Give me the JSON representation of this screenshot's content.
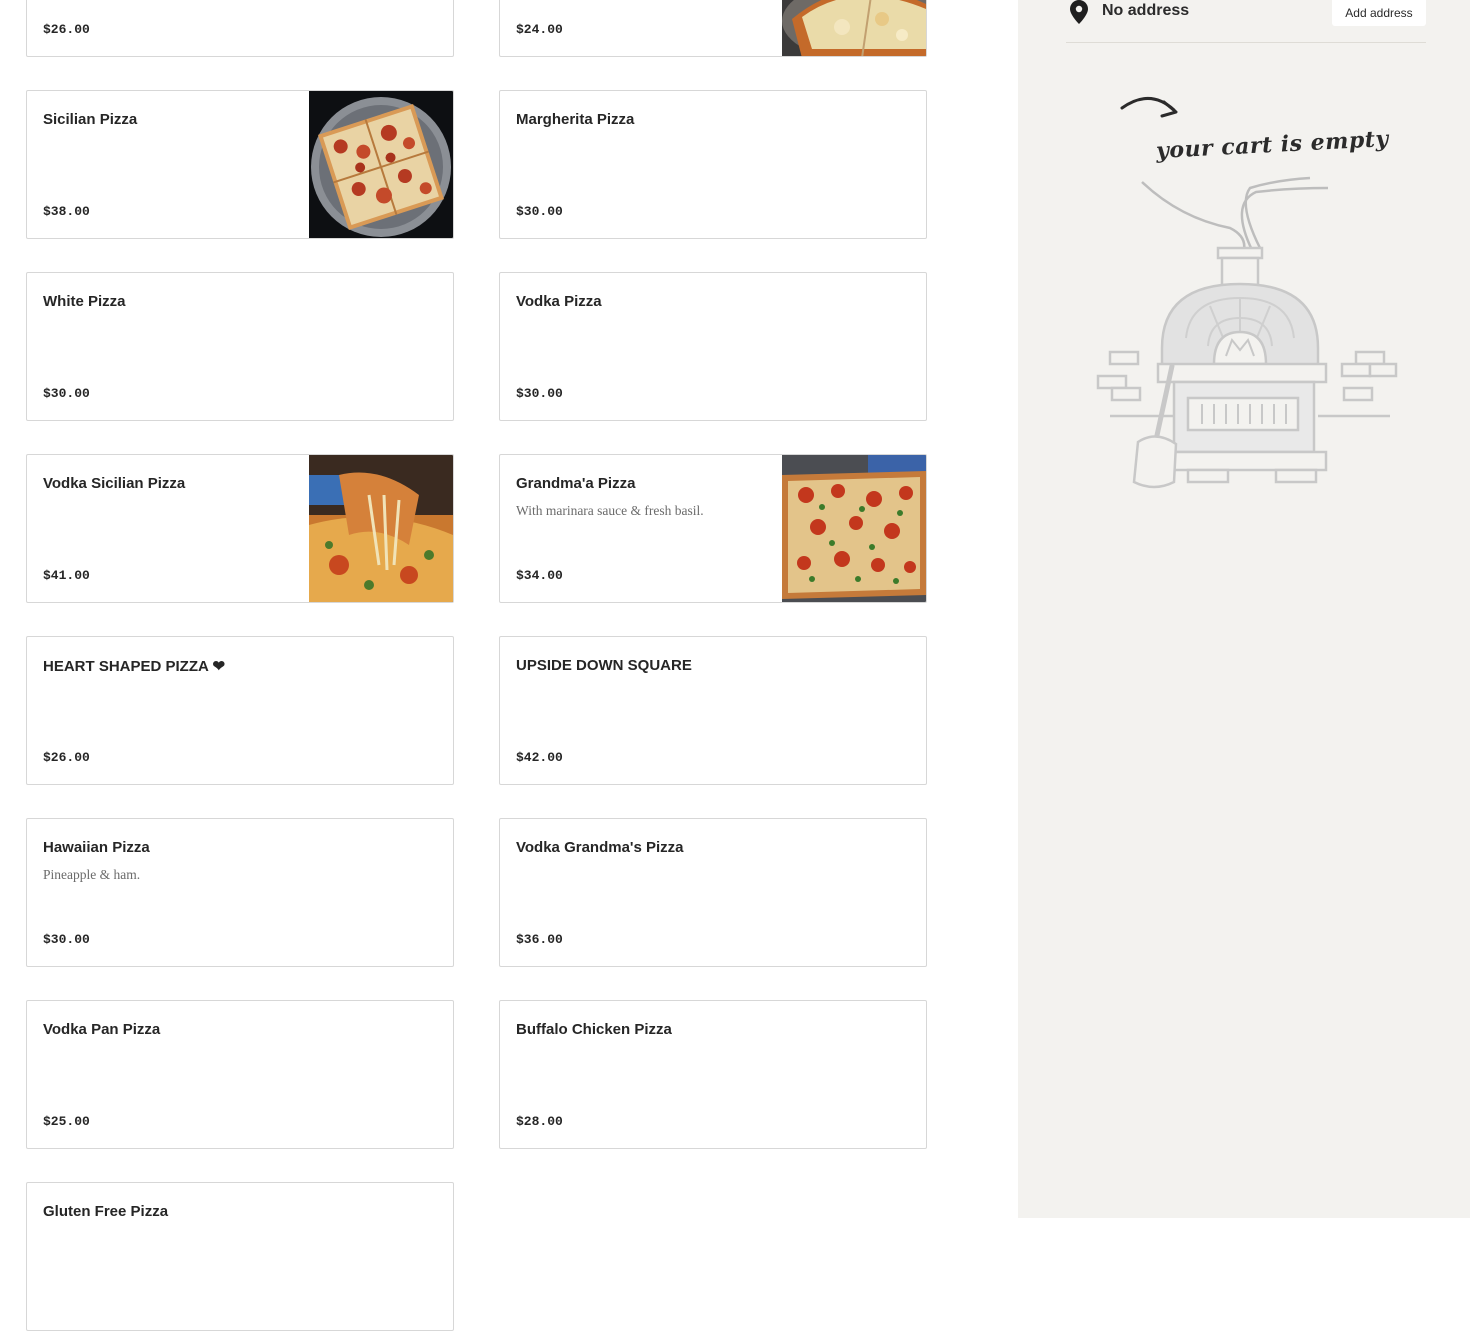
{
  "menu_items": [
    {
      "name": "",
      "description": "",
      "price": "$26.00",
      "image": false
    },
    {
      "name": "",
      "description": "",
      "price": "$24.00",
      "image": "pizza-photo"
    },
    {
      "name": "Sicilian Pizza",
      "description": "",
      "price": "$38.00",
      "image": "sicilian-pizza-photo"
    },
    {
      "name": "Margherita Pizza",
      "description": "",
      "price": "$30.00",
      "image": false
    },
    {
      "name": "White Pizza",
      "description": "",
      "price": "$30.00",
      "image": false
    },
    {
      "name": "Vodka Pizza",
      "description": "",
      "price": "$30.00",
      "image": false
    },
    {
      "name": "Vodka Sicilian Pizza",
      "description": "",
      "price": "$41.00",
      "image": "vodka-sicilian-pizza-photo"
    },
    {
      "name": "Grandma'a Pizza",
      "description": "With marinara sauce & fresh basil.",
      "price": "$34.00",
      "image": "grandma-pizza-photo"
    },
    {
      "name": "HEART SHAPED PIZZA ❤",
      "description": "",
      "price": "$26.00",
      "image": false
    },
    {
      "name": "UPSIDE DOWN SQUARE",
      "description": "",
      "price": "$42.00",
      "image": false
    },
    {
      "name": "Hawaiian Pizza",
      "description": "Pineapple & ham.",
      "price": "$30.00",
      "image": false
    },
    {
      "name": "Vodka Grandma's Pizza",
      "description": "",
      "price": "$36.00",
      "image": false
    },
    {
      "name": "Vodka Pan Pizza",
      "description": "",
      "price": "$25.00",
      "image": false
    },
    {
      "name": "Buffalo Chicken Pizza",
      "description": "",
      "price": "$28.00",
      "image": false
    },
    {
      "name": "Gluten Free Pizza",
      "description": "",
      "price": "",
      "image": false
    }
  ],
  "cart": {
    "address_text": "No address",
    "add_address_label": "Add address",
    "empty_message": "your cart is empty",
    "icons": {
      "location": "location-pin-icon",
      "empty": "pizza-oven-illustration"
    }
  },
  "colors": {
    "cart_background": "#f3f2ef",
    "card_border": "#d7d7d7",
    "text_primary": "#262626",
    "text_secondary": "#6b6b6b"
  }
}
